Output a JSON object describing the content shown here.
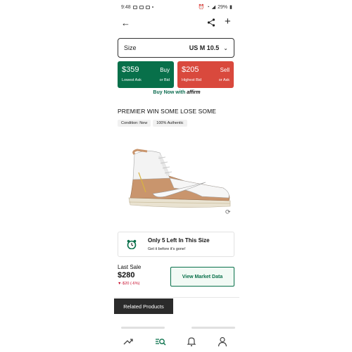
{
  "status_bar": {
    "time": "9:48",
    "battery": "29%"
  },
  "size_select": {
    "label": "Size",
    "value": "US M 10.5"
  },
  "buy_button": {
    "price": "$359",
    "action": "Buy",
    "caption": "Lowest Ask",
    "sub_action": "or Bid",
    "color": "#08704a"
  },
  "sell_button": {
    "price": "$205",
    "action": "Sell",
    "caption": "Highest Bid",
    "sub_action": "or Ask",
    "color": "#d9493d"
  },
  "buy_now": {
    "text": "Buy Now with",
    "brand": "affirm"
  },
  "product": {
    "title": "PREMIER WIN SOME LOSE SOME",
    "tags": [
      "Condition: New",
      "100% Authentic"
    ]
  },
  "stock": {
    "heading": "Only 5 Left In This Size",
    "sub": "Get it before it's gone!"
  },
  "last_sale": {
    "label": "Last Sale",
    "price": "$280",
    "change": "-$20 (-6%)"
  },
  "market_button": {
    "label": "View Market Data"
  },
  "related": {
    "label": "Related Products"
  },
  "nav": {
    "items": [
      "trending-icon",
      "search-icon",
      "bell-icon",
      "user-icon"
    ]
  }
}
